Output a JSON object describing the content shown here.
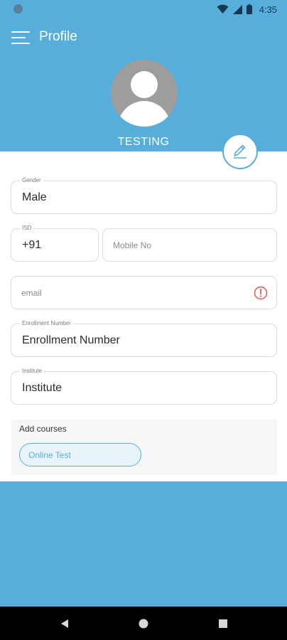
{
  "status_bar": {
    "time": "4:35",
    "icons": [
      "notification-dot-icon",
      "wifi-icon",
      "cellular-signal-icon",
      "battery-icon"
    ]
  },
  "app_bar": {
    "title": "Profile",
    "menu_icon": "hamburger-menu-icon"
  },
  "profile": {
    "username": "TESTING",
    "avatar_icon": "default-user-avatar",
    "edit_icon": "pencil-edit-icon"
  },
  "form": {
    "gender": {
      "label": "Gender",
      "value": "Male"
    },
    "isd": {
      "label": "ISD",
      "value": "+91"
    },
    "mobile": {
      "placeholder": "Mobile No"
    },
    "email": {
      "placeholder": "email",
      "status_icon": "error-alert-icon"
    },
    "enrollment": {
      "label": "Enrollment Number",
      "value": "Enrollment Number"
    },
    "institute": {
      "label": "Institute",
      "value": "Institute"
    }
  },
  "courses": {
    "title": "Add courses",
    "items": [
      {
        "label": "Online Test"
      }
    ]
  },
  "nav_bar": {
    "buttons": [
      "back-icon",
      "home-icon",
      "recents-icon"
    ]
  },
  "colors": {
    "primary": "#58aedb",
    "surface": "#ffffff",
    "error": "#e05a4e",
    "nav_bar": "#000000"
  }
}
